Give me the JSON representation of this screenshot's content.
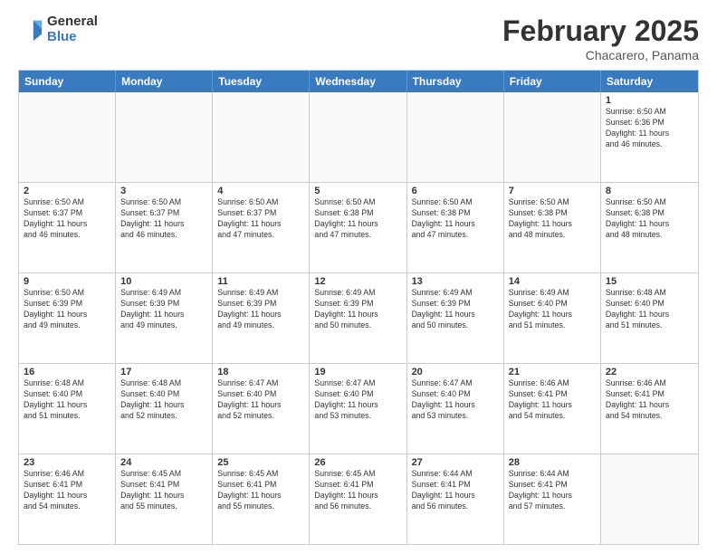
{
  "logo": {
    "general": "General",
    "blue": "Blue"
  },
  "title": "February 2025",
  "subtitle": "Chacarero, Panama",
  "days": [
    "Sunday",
    "Monday",
    "Tuesday",
    "Wednesday",
    "Thursday",
    "Friday",
    "Saturday"
  ],
  "weeks": [
    [
      {
        "day": "",
        "info": ""
      },
      {
        "day": "",
        "info": ""
      },
      {
        "day": "",
        "info": ""
      },
      {
        "day": "",
        "info": ""
      },
      {
        "day": "",
        "info": ""
      },
      {
        "day": "",
        "info": ""
      },
      {
        "day": "1",
        "info": "Sunrise: 6:50 AM\nSunset: 6:36 PM\nDaylight: 11 hours\nand 46 minutes."
      }
    ],
    [
      {
        "day": "2",
        "info": "Sunrise: 6:50 AM\nSunset: 6:37 PM\nDaylight: 11 hours\nand 46 minutes."
      },
      {
        "day": "3",
        "info": "Sunrise: 6:50 AM\nSunset: 6:37 PM\nDaylight: 11 hours\nand 46 minutes."
      },
      {
        "day": "4",
        "info": "Sunrise: 6:50 AM\nSunset: 6:37 PM\nDaylight: 11 hours\nand 47 minutes."
      },
      {
        "day": "5",
        "info": "Sunrise: 6:50 AM\nSunset: 6:38 PM\nDaylight: 11 hours\nand 47 minutes."
      },
      {
        "day": "6",
        "info": "Sunrise: 6:50 AM\nSunset: 6:38 PM\nDaylight: 11 hours\nand 47 minutes."
      },
      {
        "day": "7",
        "info": "Sunrise: 6:50 AM\nSunset: 6:38 PM\nDaylight: 11 hours\nand 48 minutes."
      },
      {
        "day": "8",
        "info": "Sunrise: 6:50 AM\nSunset: 6:38 PM\nDaylight: 11 hours\nand 48 minutes."
      }
    ],
    [
      {
        "day": "9",
        "info": "Sunrise: 6:50 AM\nSunset: 6:39 PM\nDaylight: 11 hours\nand 49 minutes."
      },
      {
        "day": "10",
        "info": "Sunrise: 6:49 AM\nSunset: 6:39 PM\nDaylight: 11 hours\nand 49 minutes."
      },
      {
        "day": "11",
        "info": "Sunrise: 6:49 AM\nSunset: 6:39 PM\nDaylight: 11 hours\nand 49 minutes."
      },
      {
        "day": "12",
        "info": "Sunrise: 6:49 AM\nSunset: 6:39 PM\nDaylight: 11 hours\nand 50 minutes."
      },
      {
        "day": "13",
        "info": "Sunrise: 6:49 AM\nSunset: 6:39 PM\nDaylight: 11 hours\nand 50 minutes."
      },
      {
        "day": "14",
        "info": "Sunrise: 6:49 AM\nSunset: 6:40 PM\nDaylight: 11 hours\nand 51 minutes."
      },
      {
        "day": "15",
        "info": "Sunrise: 6:48 AM\nSunset: 6:40 PM\nDaylight: 11 hours\nand 51 minutes."
      }
    ],
    [
      {
        "day": "16",
        "info": "Sunrise: 6:48 AM\nSunset: 6:40 PM\nDaylight: 11 hours\nand 51 minutes."
      },
      {
        "day": "17",
        "info": "Sunrise: 6:48 AM\nSunset: 6:40 PM\nDaylight: 11 hours\nand 52 minutes."
      },
      {
        "day": "18",
        "info": "Sunrise: 6:47 AM\nSunset: 6:40 PM\nDaylight: 11 hours\nand 52 minutes."
      },
      {
        "day": "19",
        "info": "Sunrise: 6:47 AM\nSunset: 6:40 PM\nDaylight: 11 hours\nand 53 minutes."
      },
      {
        "day": "20",
        "info": "Sunrise: 6:47 AM\nSunset: 6:40 PM\nDaylight: 11 hours\nand 53 minutes."
      },
      {
        "day": "21",
        "info": "Sunrise: 6:46 AM\nSunset: 6:41 PM\nDaylight: 11 hours\nand 54 minutes."
      },
      {
        "day": "22",
        "info": "Sunrise: 6:46 AM\nSunset: 6:41 PM\nDaylight: 11 hours\nand 54 minutes."
      }
    ],
    [
      {
        "day": "23",
        "info": "Sunrise: 6:46 AM\nSunset: 6:41 PM\nDaylight: 11 hours\nand 54 minutes."
      },
      {
        "day": "24",
        "info": "Sunrise: 6:45 AM\nSunset: 6:41 PM\nDaylight: 11 hours\nand 55 minutes."
      },
      {
        "day": "25",
        "info": "Sunrise: 6:45 AM\nSunset: 6:41 PM\nDaylight: 11 hours\nand 55 minutes."
      },
      {
        "day": "26",
        "info": "Sunrise: 6:45 AM\nSunset: 6:41 PM\nDaylight: 11 hours\nand 56 minutes."
      },
      {
        "day": "27",
        "info": "Sunrise: 6:44 AM\nSunset: 6:41 PM\nDaylight: 11 hours\nand 56 minutes."
      },
      {
        "day": "28",
        "info": "Sunrise: 6:44 AM\nSunset: 6:41 PM\nDaylight: 11 hours\nand 57 minutes."
      },
      {
        "day": "",
        "info": ""
      }
    ]
  ]
}
